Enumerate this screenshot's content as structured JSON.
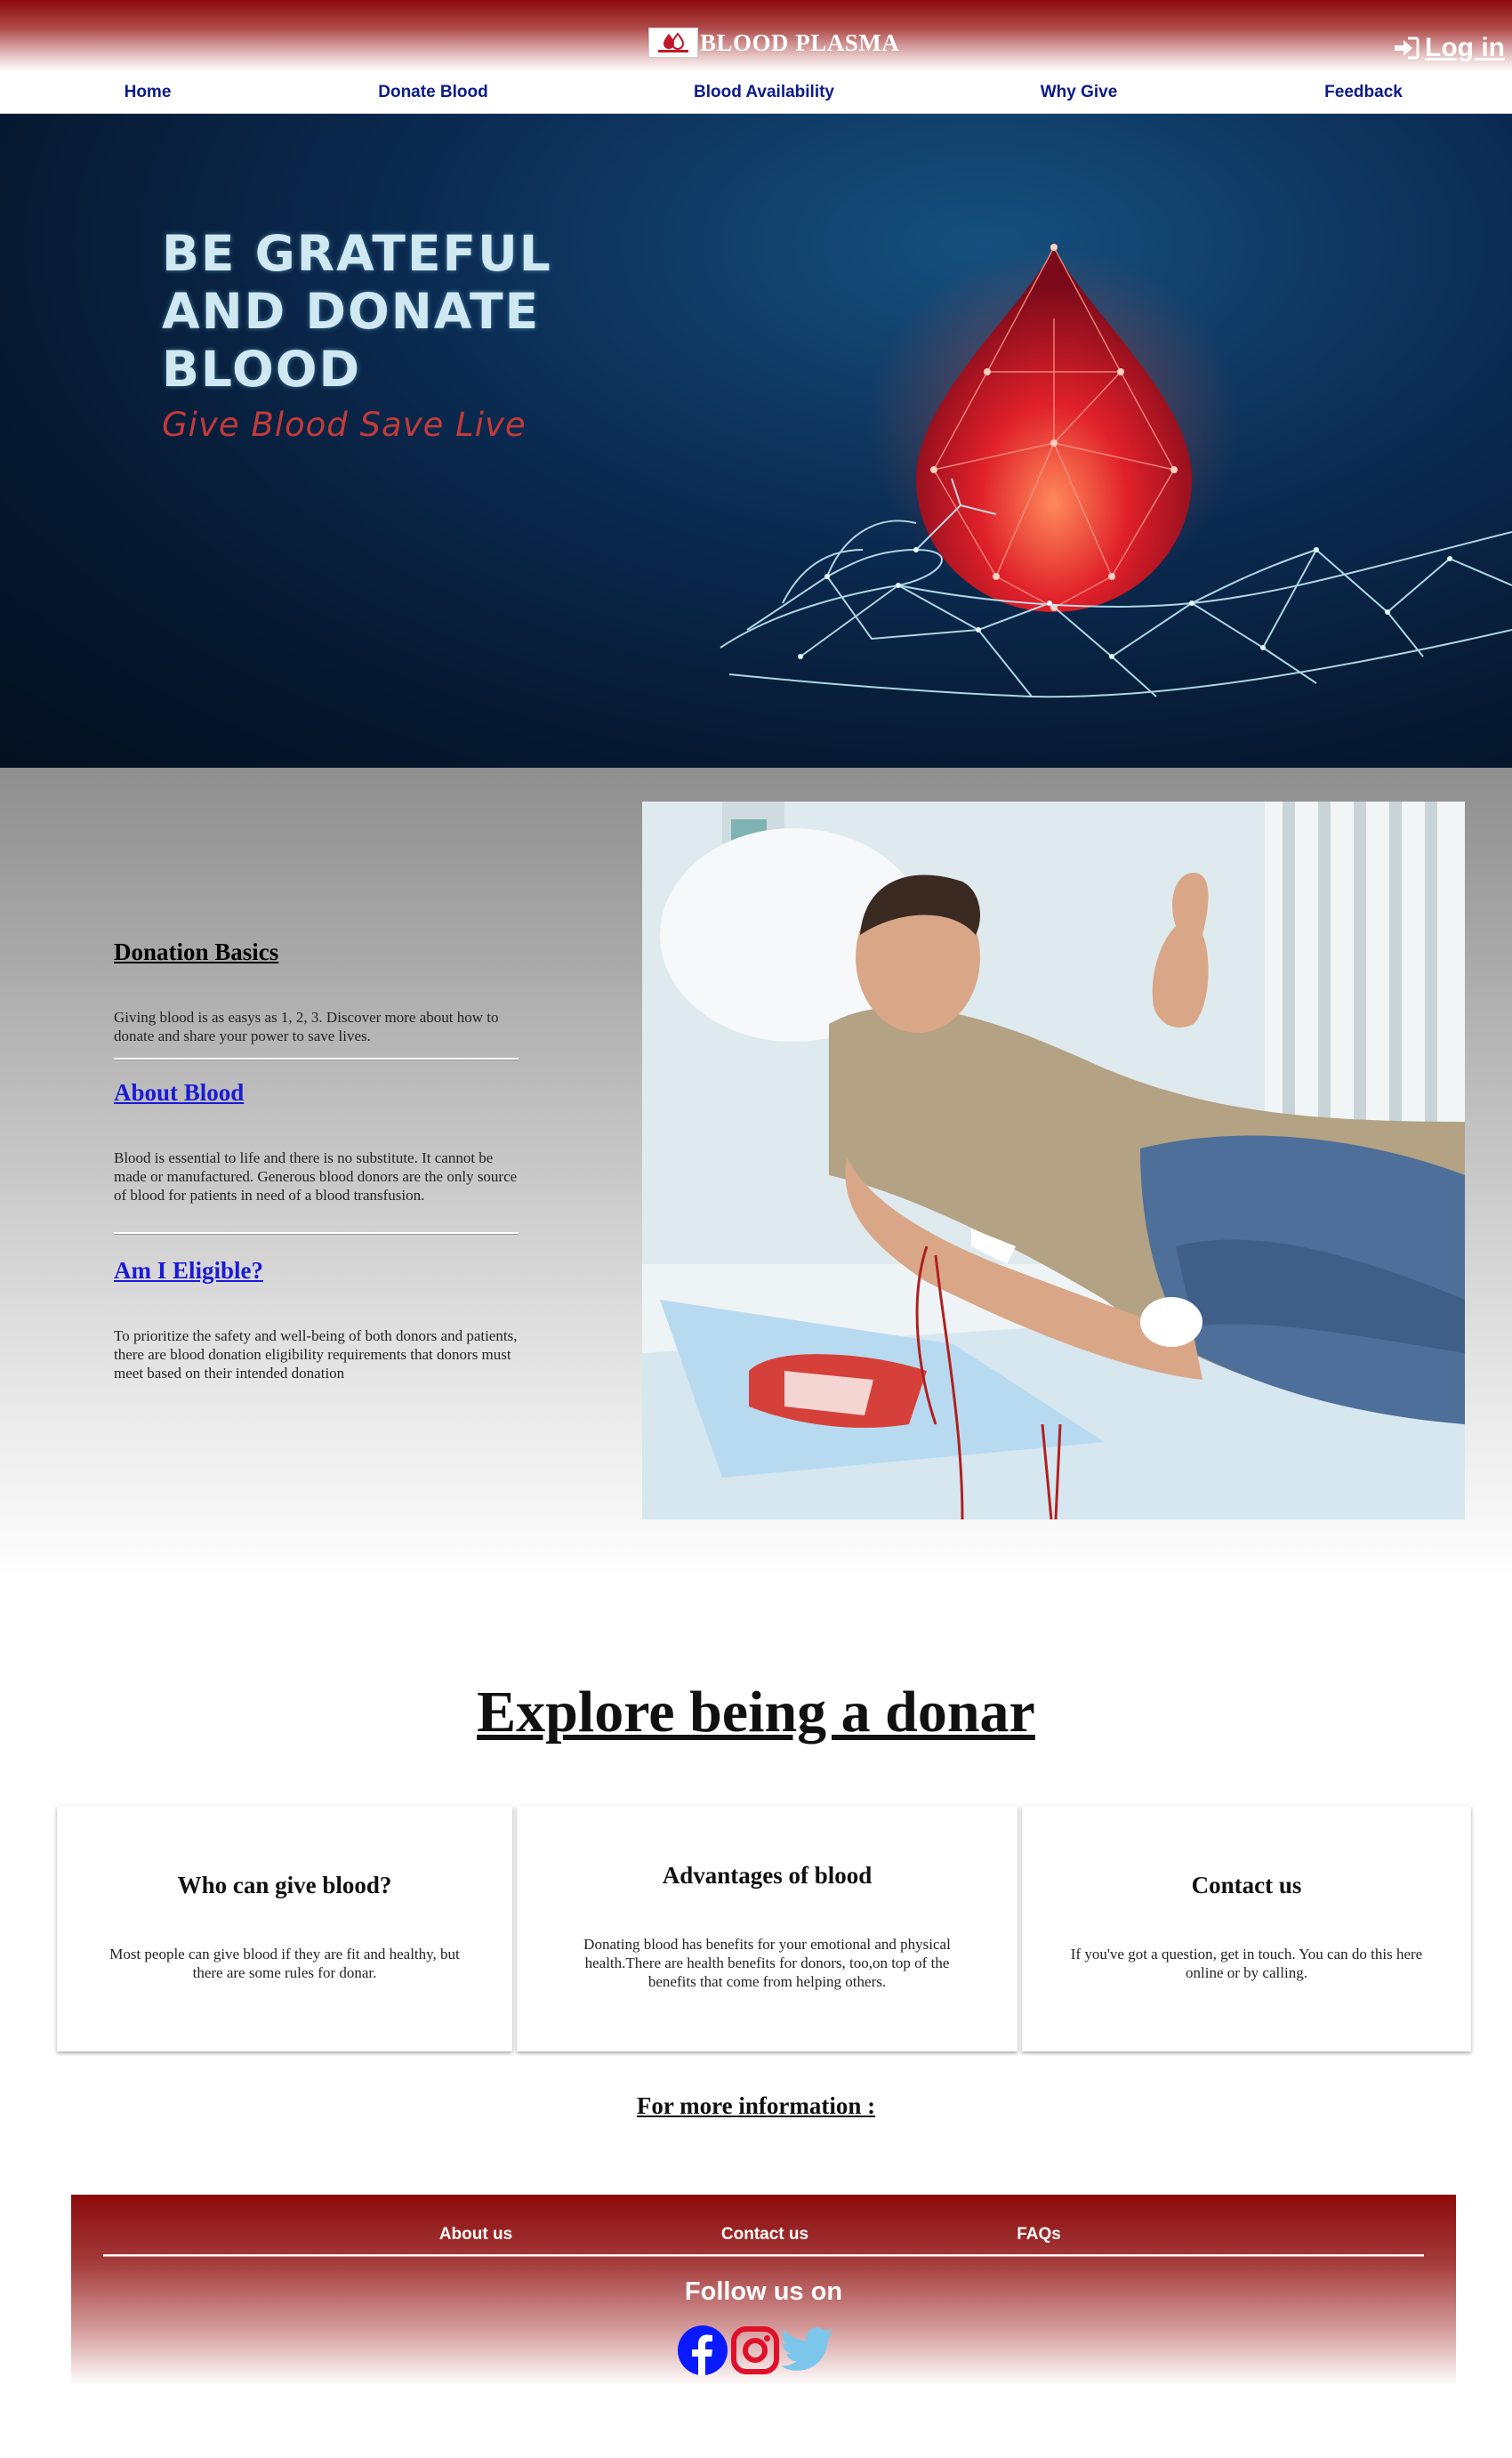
{
  "header": {
    "brand_title": "BLOOD PLASMA",
    "login_label": "Log in",
    "nav": [
      "Home",
      "Donate Blood",
      "Blood Availability",
      "Why Give",
      "Feedback"
    ]
  },
  "hero": {
    "headline_lines": [
      "BE GRATEFUL",
      "AND DONATE",
      "BLOOD"
    ],
    "tagline": "Give Blood  Save Live"
  },
  "info": {
    "sections": [
      {
        "title": "Donation Basics",
        "body": "Giving blood is as easys as 1, 2, 3. Discover more about how to donate and share your power to save lives."
      },
      {
        "title": "About Blood",
        "body": "Blood is essential to life and there is no substitute. It cannot be made or manufactured. Generous blood donors are the only source of blood for patients in need of a blood transfusion."
      },
      {
        "title": "Am I Eligible?",
        "body": "To prioritize the safety and well-being of both donors and patients, there are blood donation eligibility requirements that donors must meet based on their intended donation"
      }
    ]
  },
  "explore": {
    "title": "Explore being a donar",
    "cards": [
      {
        "title": "Who can give blood?",
        "body": "Most people can give blood if they are fit and healthy, but there are some rules for donar."
      },
      {
        "title": "Advantages of blood",
        "body": "Donating blood has benefits for your emotional and physical health.There are health benefits for donors, too,on top of the benefits that come from helping others."
      },
      {
        "title": "Contact us",
        "body": "If you've got a question, get in touch. You can do this here online or by calling."
      }
    ],
    "more_info": "For more information :"
  },
  "footer": {
    "links": [
      "About us",
      "Contact us",
      "FAQs"
    ],
    "follow_label": "Follow us on",
    "socials": [
      "facebook-icon",
      "instagram-icon",
      "twitter-icon"
    ]
  },
  "colors": {
    "header_red": "#8b0a0a",
    "nav_blue": "#0a1a8c",
    "link_blue": "#1a1ad6",
    "facebook_blue": "#0a1aff",
    "instagram_red": "#e0102a",
    "twitter_blue": "#7cc6ec"
  }
}
